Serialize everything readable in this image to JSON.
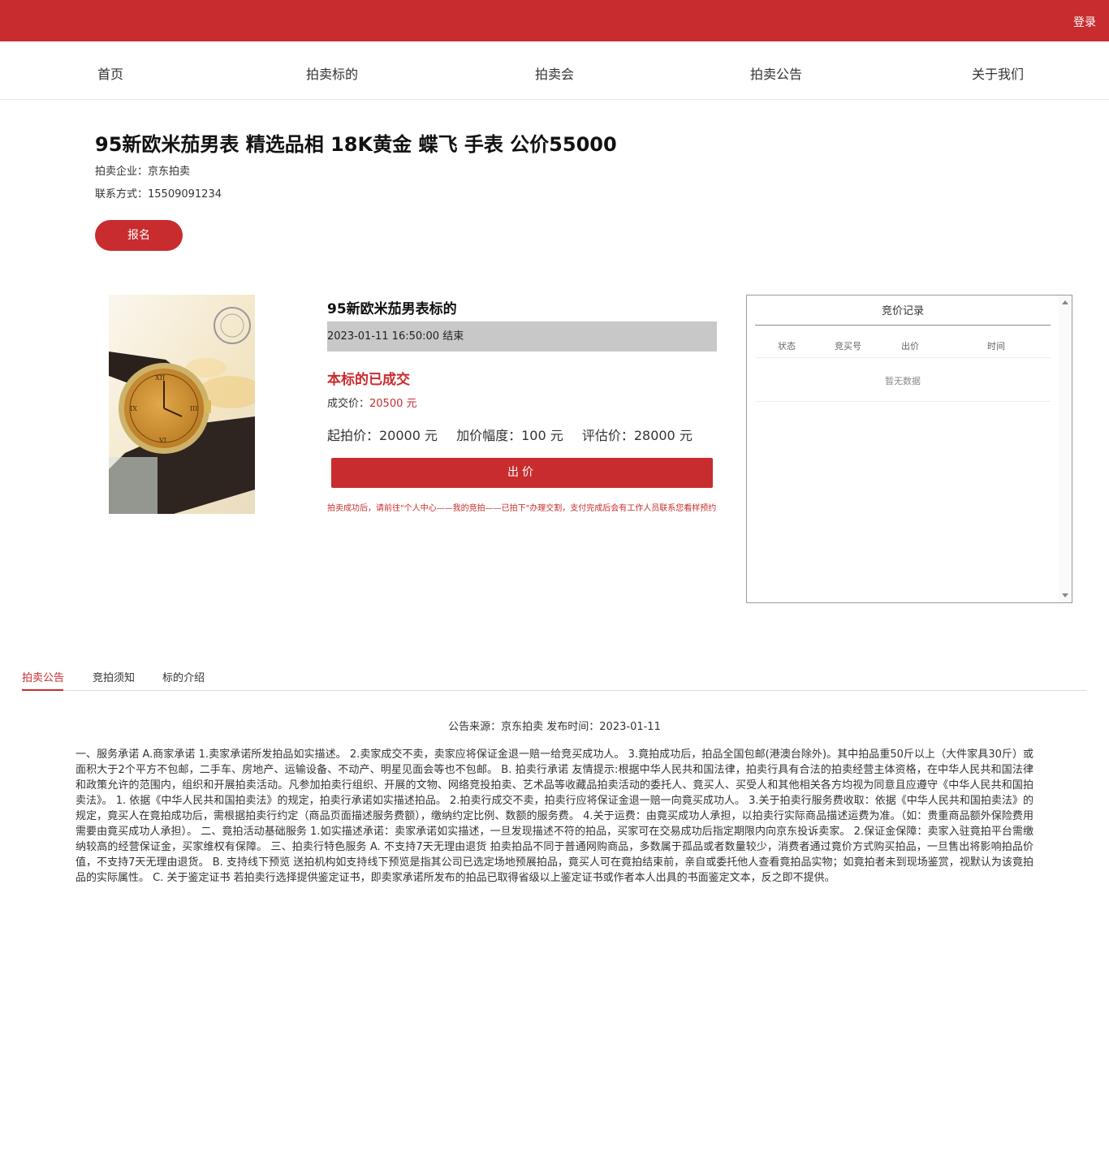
{
  "header": {
    "login_label": "登录"
  },
  "nav": {
    "items": [
      "首页",
      "拍卖标的",
      "拍卖会",
      "拍卖公告",
      "关于我们"
    ]
  },
  "lot": {
    "title": "95新欧米茄男表 精选品相 18K黄金 蝶飞 手表 公价55000",
    "company": "拍卖企业：京东拍卖",
    "contact": "联系方式：15509091234",
    "signup_label": "报名",
    "name": "95新欧米茄男表标的",
    "end_time": "2023-01-11 16:50:00 结束",
    "status": "本标的已成交",
    "deal_label": "成交价：",
    "deal_price": "20500 元",
    "start_price": "起拍价：20000 元",
    "increment": "加价幅度：100 元",
    "estimate": "评估价：28000 元",
    "bid_label": "出价",
    "notice": "拍卖成功后，请前往\"个人中心——我的竞拍——已拍下\"办理交割，支付完成后会有工作人员联系您看样预约"
  },
  "record": {
    "title": "竞价记录",
    "columns": [
      "状态",
      "竞买号",
      "出价",
      "时间"
    ],
    "empty": "暂无数据"
  },
  "tabs": {
    "items": [
      "拍卖公告",
      "竞拍须知",
      "标的介绍"
    ],
    "active": 0
  },
  "announcement": {
    "source": "公告来源：京东拍卖 发布时间：2023-01-11",
    "body": "一、服务承诺 A.商家承诺 1.卖家承诺所发拍品如实描述。 2.卖家成交不卖，卖家应将保证金退一赔一给竞买成功人。 3.竟拍成功后，拍品全国包邮(港澳台除外)。其中拍品重50斤以上（大件家具30斤）或面积大于2个平方不包邮，二手车、房地产、运输设备、不动产、明星见面会等也不包邮。 B. 拍卖行承诺 友情提示:根据中华人民共和国法律，拍卖行具有合法的拍卖经营主体资格，在中华人民共和国法律和政策允许的范围内，组织和开展拍卖活动。凡参加拍卖行组织、开展的文物、网络竞投拍卖、艺术品等收藏品拍卖活动的委托人、竟买人、买受人和其他相关各方均视为同意且应遵守《中华人民共和国拍卖法》。 1. 依据《中华人民共和国拍卖法》的规定，拍卖行承诺如实描述拍品。 2.拍卖行成交不卖，拍卖行应将保证金退一赔一向竟买成功人。 3.关于拍卖行服务费收取：依据《中华人民共和国拍卖法》的规定，竟买人在竟拍成功后，需根据拍卖行约定（商品页面描述服务费额），缴纳约定比例、数额的服务费。 4.关于运费：由竟买成功人承担，以拍卖行实际商品描述运费为准。（如：贵重商品额外保险费用需要由竟买成功人承担）。 二、竟拍活动基础服务 1.如实描述承诺：卖家承诺如实描述，一旦发现描述不符的拍品，买家可在交易成功后指定期限内向京东投诉卖家。 2.保证金保障：卖家入驻竟拍平台需缴纳较高的经营保证金，买家维权有保障。 三、拍卖行特色服务 A. 不支持7天无理由退货 拍卖拍品不同于普通网购商品，多数属于孤品或者数量较少，消费者通过竟价方式购买拍品，一旦售出将影响拍品价值，不支持7天无理由退货。 B. 支持线下预览 送拍机构如支持线下预览是指其公司已选定场地预展拍品，竟买人可在竟拍结束前，亲自或委托他人查看竟拍品实物；如竟拍者未到现场鉴赏，视默认为该竟拍品的实际属性。 C. 关于鉴定证书 若拍卖行选择提供鉴定证书，即卖家承诺所发布的拍品已取得省级以上鉴定证书或作者本人出具的书面鉴定文本，反之即不提供。"
  },
  "colors": {
    "brand": "#c92c2e"
  },
  "icons": [
    "watch-photo",
    "scroll-up-icon",
    "scroll-down-icon"
  ]
}
